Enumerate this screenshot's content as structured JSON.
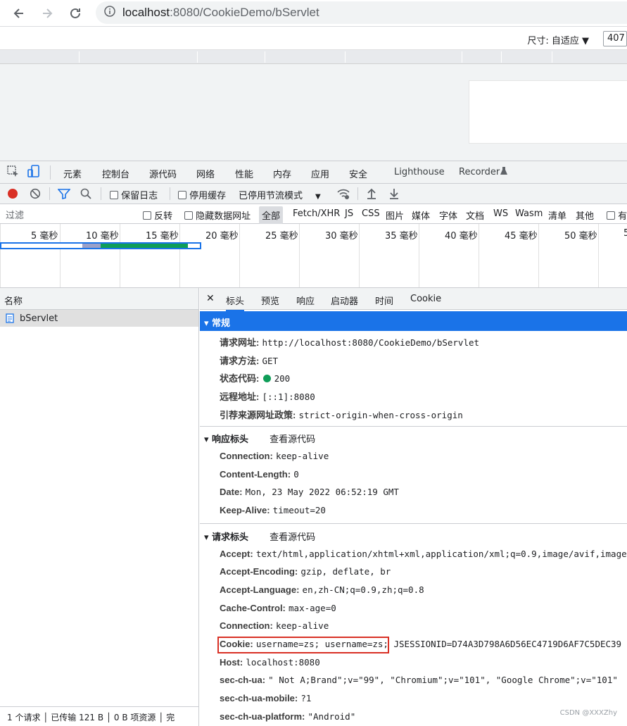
{
  "browser": {
    "url_host": "localhost",
    "url_rest": ":8080/CookieDemo/bServlet"
  },
  "device_toolbar": {
    "size_label": "尺寸: 自适应 ▼",
    "size_value": "407"
  },
  "devtools_tabs": [
    "元素",
    "控制台",
    "源代码",
    "网络",
    "性能",
    "内存",
    "应用",
    "安全",
    "Lighthouse",
    "Recorder"
  ],
  "network_toolbar": {
    "preserve_log": "保留日志",
    "disable_cache": "停用缓存",
    "throttling": "已停用节流模式"
  },
  "filter_bar": {
    "filter_placeholder": "过滤",
    "invert": "反转",
    "hide_data_urls": "隐藏数据网址",
    "types": [
      "全部",
      "Fetch/XHR",
      "JS",
      "CSS",
      "图片",
      "媒体",
      "字体",
      "文档",
      "WS",
      "Wasm",
      "清单",
      "其他"
    ],
    "trailing": "有"
  },
  "timeline": {
    "ticks": [
      "5 毫秒",
      "10 毫秒",
      "15 毫秒",
      "20 毫秒",
      "25 毫秒",
      "30 毫秒",
      "35 毫秒",
      "40 毫秒",
      "45 毫秒",
      "50 毫秒",
      "5"
    ]
  },
  "request_list": {
    "header": "名称",
    "items": [
      "bServlet"
    ],
    "status": "1 个请求 │ 已传输 121 B │ 0 B 项资源 │ 完"
  },
  "detail_tabs": [
    "标头",
    "预览",
    "响应",
    "启动器",
    "时间",
    "Cookie"
  ],
  "general": {
    "title": "▾ 常规",
    "rows": [
      {
        "k": "请求网址:",
        "v": "http://localhost:8080/CookieDemo/bServlet"
      },
      {
        "k": "请求方法:",
        "v": "GET"
      },
      {
        "k": "状态代码:",
        "v": "200"
      },
      {
        "k": "远程地址:",
        "v": "[::1]:8080"
      },
      {
        "k": "引荐来源网址政策:",
        "v": "strict-origin-when-cross-origin"
      }
    ]
  },
  "response_headers": {
    "title": "▾ 响应标头",
    "view_source": "查看源代码",
    "rows": [
      {
        "k": "Connection:",
        "v": "keep-alive"
      },
      {
        "k": "Content-Length:",
        "v": "0"
      },
      {
        "k": "Date:",
        "v": "Mon, 23 May 2022 06:52:19 GMT"
      },
      {
        "k": "Keep-Alive:",
        "v": "timeout=20"
      }
    ]
  },
  "request_headers": {
    "title": "▾ 请求标头",
    "view_source": "查看源代码",
    "rows": [
      {
        "k": "Accept:",
        "v": "text/html,application/xhtml+xml,application/xml;q=0.9,image/avif,image/"
      },
      {
        "k": "Accept-Encoding:",
        "v": "gzip, deflate, br"
      },
      {
        "k": "Accept-Language:",
        "v": "en,zh-CN;q=0.9,zh;q=0.8"
      },
      {
        "k": "Cache-Control:",
        "v": "max-age=0"
      },
      {
        "k": "Connection:",
        "v": "keep-alive"
      },
      {
        "k": "Cookie:",
        "v": "username=zs; username=zs; JSESSIONID=D74A3D798A6D56EC4719D6AF7C5DEC39"
      },
      {
        "k": "Host:",
        "v": "localhost:8080"
      },
      {
        "k": "sec-ch-ua:",
        "v": "\" Not A;Brand\";v=\"99\", \"Chromium\";v=\"101\", \"Google Chrome\";v=\"101\""
      },
      {
        "k": "sec-ch-ua-mobile:",
        "v": "?1"
      },
      {
        "k": "sec-ch-ua-platform:",
        "v": "\"Android\""
      }
    ]
  },
  "watermark": "CSDN @XXXZhy",
  "colors": {
    "accent": "#1a73e8",
    "record": "#d93025",
    "status_ok": "#0f9d58"
  }
}
